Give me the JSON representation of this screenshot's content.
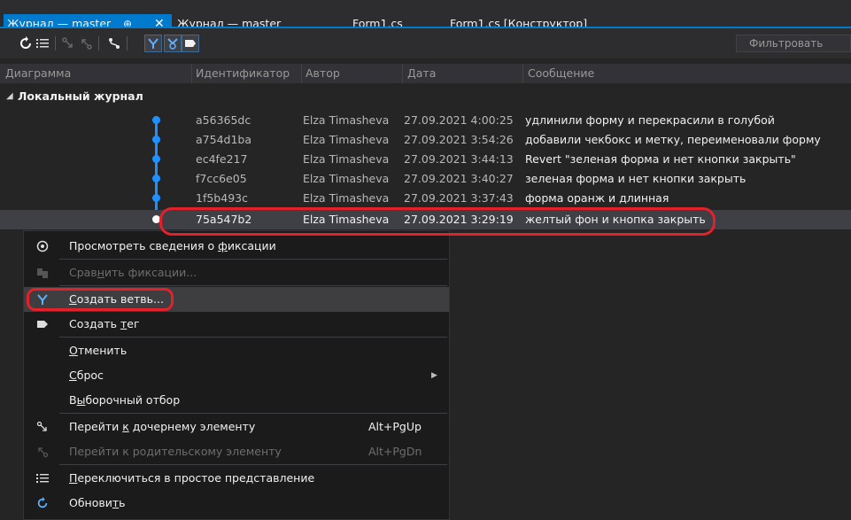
{
  "tabs": [
    {
      "label": "Журнал — master",
      "active": true,
      "pin_glyph": "⊕",
      "close_glyph": "✕"
    },
    {
      "label": "Журнал — master"
    },
    {
      "label": "Form1.cs"
    },
    {
      "label": "Form1.cs [Конструктор]"
    }
  ],
  "toolbar": {
    "filter_placeholder": "Фильтровать",
    "icons": [
      "refresh-icon",
      "list-view-icon",
      "go-child-icon",
      "go-parent-icon",
      "graph-toggle-icon",
      "create-branch-icon",
      "local-remote-icon",
      "show-tags-icon"
    ]
  },
  "columns": [
    "Диаграмма",
    "Идентификатор",
    "Автор",
    "Дата",
    "Сообщение"
  ],
  "group": {
    "label": "Локальный журнал",
    "expanded_glyph": "◢"
  },
  "commits": [
    {
      "id": "a56365dc",
      "author": "Elza Timasheva",
      "date": "27.09.2021 4:00:25",
      "message": "удлинили форму и перекрасили в голубой"
    },
    {
      "id": "a754d1ba",
      "author": "Elza Timasheva",
      "date": "27.09.2021 3:54:26",
      "message": "добавили чекбокс и метку, переименовали форму"
    },
    {
      "id": "ec4fe217",
      "author": "Elza Timasheva",
      "date": "27.09.2021 3:44:13",
      "message": "Revert \"зеленая форма и нет кнопки закрыть\""
    },
    {
      "id": "f7cc6e05",
      "author": "Elza Timasheva",
      "date": "27.09.2021 3:40:27",
      "message": "зеленая форма и нет кнопки закрыть"
    },
    {
      "id": "1f5b493c",
      "author": "Elza Timasheva",
      "date": "27.09.2021 3:37:43",
      "message": "форма оранж и длинная"
    },
    {
      "id": "75a547b2",
      "author": "Elza Timasheva",
      "date": "27.09.2021 3:29:19",
      "message": "желтый фон и кнопка закрыть",
      "selected": true
    }
  ],
  "menu": {
    "view_details": {
      "pre": "Просмотреть сведения о ",
      "key": "ф",
      "post": "иксации"
    },
    "compare": {
      "pre": "Срав",
      "key": "н",
      "post": "ить фиксации..."
    },
    "create_branch": {
      "pre": "",
      "key": "С",
      "post": "оздать ветвь..."
    },
    "create_tag": {
      "pre": "Создать ",
      "key": "т",
      "post": "ег"
    },
    "revert": {
      "pre": "",
      "key": "О",
      "post": "тменить"
    },
    "reset": {
      "pre": "",
      "key": "С",
      "post": "брос"
    },
    "cherry_pick": {
      "pre": "В",
      "key": "ы",
      "post": "борочный отбор"
    },
    "go_child": {
      "pre": "Перейти ",
      "key": "к",
      "post": " дочернему элементу",
      "shortcut": "Alt+PgUp"
    },
    "go_parent": {
      "pre": "Перейти к родительскому элементу",
      "key": "",
      "post": "",
      "shortcut": "Alt+PgDn"
    },
    "simple_view": {
      "pre": "",
      "key": "П",
      "post": "ереключиться в простое представление"
    },
    "refresh": {
      "pre": "Обнови",
      "key": "т",
      "post": "ь"
    },
    "submenu_glyph": "▶"
  }
}
